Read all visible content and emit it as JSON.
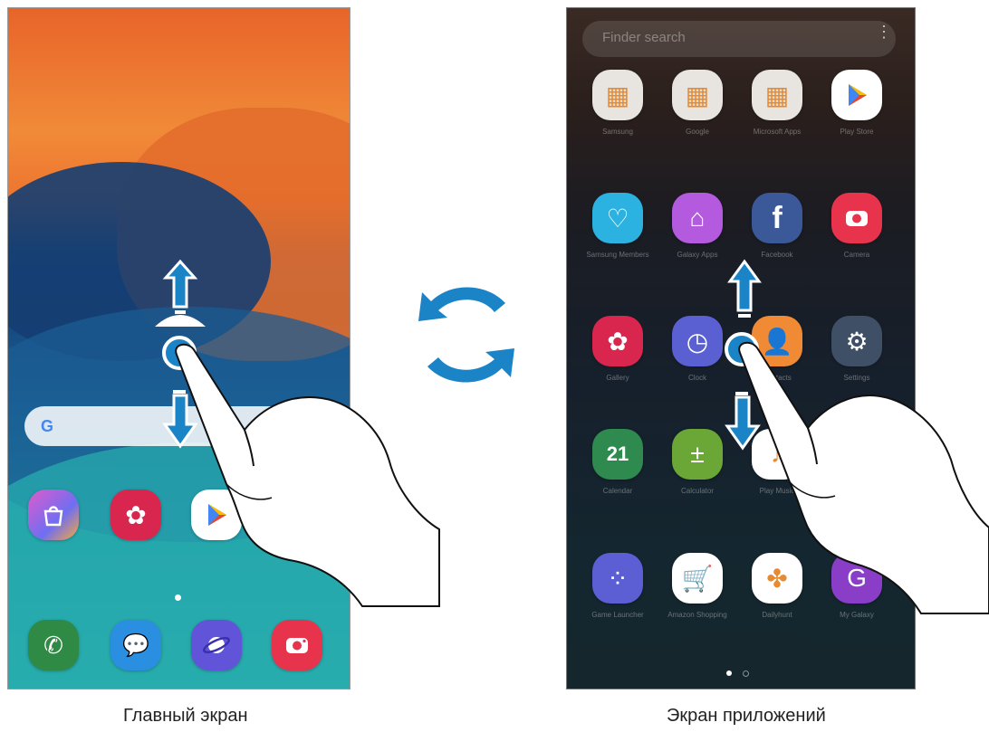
{
  "left_phone": {
    "caption": "Главный экран",
    "dock_icons": [
      "phone-icon",
      "messages-icon",
      "internet-icon",
      "camera-icon"
    ],
    "home_icons": [
      "galaxy-apps-icon",
      "gallery-icon",
      "play-store-icon"
    ]
  },
  "right_phone": {
    "caption": "Экран приложений",
    "search_placeholder": "Finder search",
    "apps": [
      {
        "label": "Samsung",
        "icon": "samsung-folder-icon",
        "color": "#e8e4e0"
      },
      {
        "label": "Google",
        "icon": "google-folder-icon",
        "color": "#e8e4e0"
      },
      {
        "label": "Microsoft Apps",
        "icon": "microsoft-folder-icon",
        "color": "#e8e4e0"
      },
      {
        "label": "Play Store",
        "icon": "play-store-icon",
        "color": "#ffffff"
      },
      {
        "label": "Samsung Members",
        "icon": "members-icon",
        "color": "#2bb2e0"
      },
      {
        "label": "Galaxy Apps",
        "icon": "galaxy-apps-icon",
        "color": "#b45adf"
      },
      {
        "label": "Facebook",
        "icon": "facebook-icon",
        "color": "#3b5998"
      },
      {
        "label": "Camera",
        "icon": "camera-icon",
        "color": "#e8334d"
      },
      {
        "label": "Gallery",
        "icon": "gallery-icon",
        "color": "#d8264f"
      },
      {
        "label": "Clock",
        "icon": "clock-icon",
        "color": "#5a5fd2"
      },
      {
        "label": "Contacts",
        "icon": "contacts-icon",
        "color": "#f08a34"
      },
      {
        "label": "Settings",
        "icon": "settings-icon",
        "color": "#3e4f66"
      },
      {
        "label": "Calendar",
        "icon": "calendar-icon",
        "color": "#2e8a4e"
      },
      {
        "label": "Calculator",
        "icon": "calculator-icon",
        "color": "#6aa736"
      },
      {
        "label": "Play Music",
        "icon": "play-music-icon",
        "color": "#ffffff"
      },
      {
        "label": "",
        "icon": "empty",
        "color": "transparent"
      },
      {
        "label": "Game Launcher",
        "icon": "game-launcher-icon",
        "color": "#5b5fd3"
      },
      {
        "label": "Amazon Shopping",
        "icon": "amazon-icon",
        "color": "#ffffff"
      },
      {
        "label": "Dailyhunt",
        "icon": "dailyhunt-icon",
        "color": "#ffffff"
      },
      {
        "label": "My Galaxy",
        "icon": "my-galaxy-icon",
        "color": "#8a3ec8"
      }
    ],
    "calendar_day": "21"
  }
}
